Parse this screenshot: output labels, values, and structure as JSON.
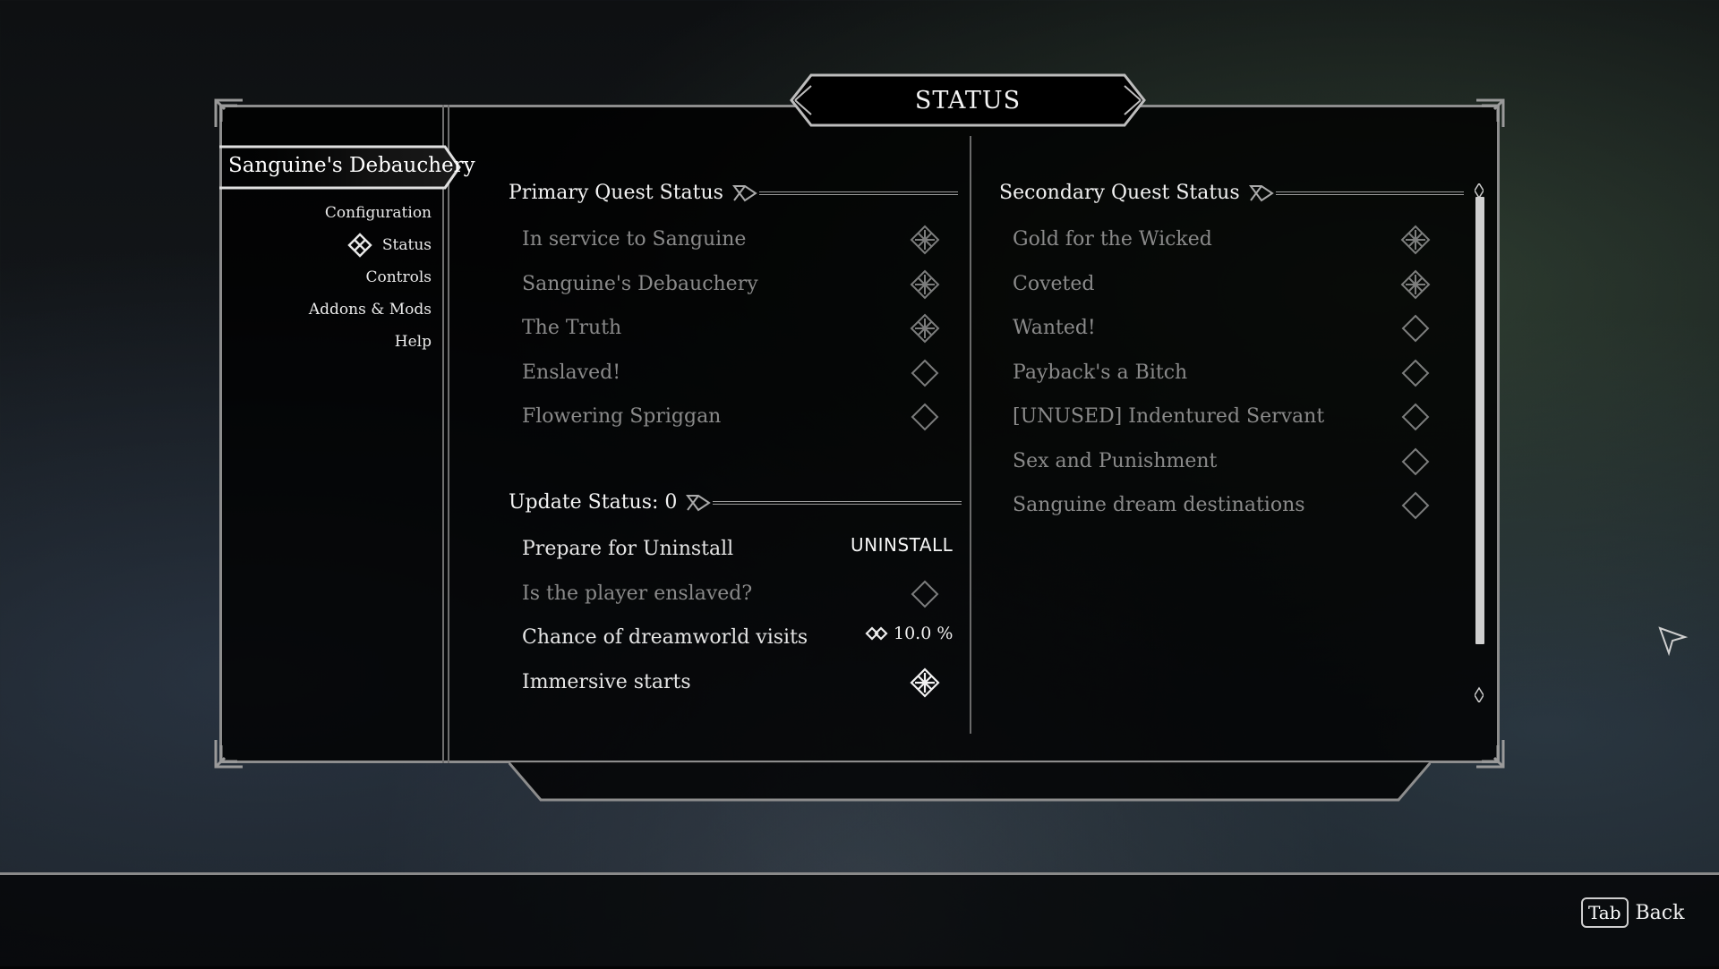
{
  "title": "STATUS",
  "sidebar": {
    "active_mod": "Sanguine's Debauchery",
    "items": [
      {
        "label": "Configuration"
      },
      {
        "label": "Status",
        "selected": true
      },
      {
        "label": "Controls"
      },
      {
        "label": "Addons & Mods"
      },
      {
        "label": "Help"
      }
    ]
  },
  "primary": {
    "header": "Primary Quest Status",
    "rows": [
      {
        "label": "In service to Sanguine",
        "checked": true
      },
      {
        "label": "Sanguine's Debauchery",
        "checked": true
      },
      {
        "label": "The Truth",
        "checked": true
      },
      {
        "label": "Enslaved!",
        "checked": false
      },
      {
        "label": "Flowering Spriggan",
        "checked": false
      }
    ]
  },
  "update": {
    "header": "Update Status: 0",
    "uninstall_label": "Prepare for Uninstall",
    "uninstall_button": "UNINSTALL",
    "enslaved_label": "Is the player enslaved?",
    "enslaved_checked": false,
    "dream_label": "Chance of dreamworld visits",
    "dream_value": "10.0 %",
    "immersive_label": "Immersive starts",
    "immersive_checked": true
  },
  "secondary": {
    "header": "Secondary Quest Status",
    "rows": [
      {
        "label": "Gold for the Wicked",
        "checked": true
      },
      {
        "label": "Coveted",
        "checked": true
      },
      {
        "label": "Wanted!",
        "checked": false
      },
      {
        "label": "Payback's a Bitch",
        "checked": false
      },
      {
        "label": "[UNUSED] Indentured Servant",
        "checked": false
      },
      {
        "label": "Sex and Punishment",
        "checked": false
      },
      {
        "label": "Sanguine dream destinations",
        "checked": false
      }
    ]
  },
  "footer": {
    "key": "Tab",
    "back_label": "Back"
  },
  "colors": {
    "frame": "#8d8d8d",
    "text_bright": "#e6e6e6",
    "text_dim": "#8a8a8a"
  }
}
